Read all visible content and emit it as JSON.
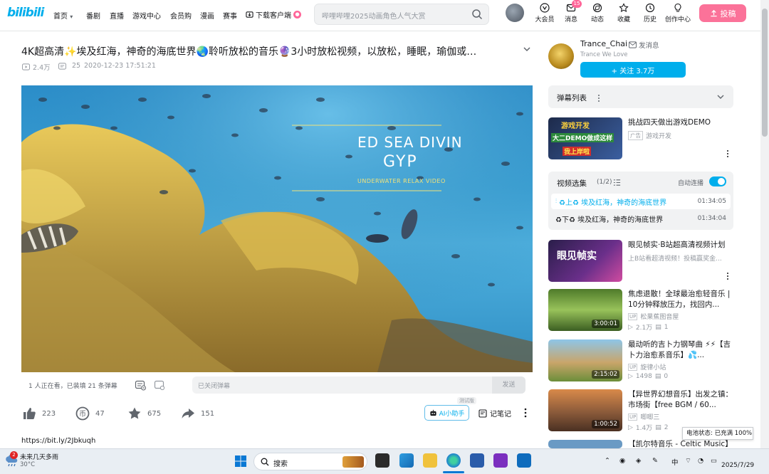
{
  "header": {
    "logo": "bilibili",
    "nav": [
      {
        "label": "首页"
      },
      {
        "label": "番剧"
      },
      {
        "label": "直播"
      },
      {
        "label": "游戏中心"
      },
      {
        "label": "会员购"
      },
      {
        "label": "漫画"
      },
      {
        "label": "赛事"
      },
      {
        "label": "下载客户端"
      }
    ],
    "search_placeholder": "哔哩哔哩2025动画角色人气大赏",
    "user_menu": [
      {
        "label": "大会员",
        "icon": "vip-icon"
      },
      {
        "label": "消息",
        "icon": "message-icon",
        "badge": "15"
      },
      {
        "label": "动态",
        "icon": "dynamic-icon"
      },
      {
        "label": "收藏",
        "icon": "star-icon"
      },
      {
        "label": "历史",
        "icon": "history-icon"
      },
      {
        "label": "创作中心",
        "icon": "bulb-icon"
      }
    ],
    "upload_label": "投稿"
  },
  "video": {
    "title": "4K超高清✨埃及红海，神奇的海底世界🌏聆听放松的音乐🔮3小时放松视频，以放松，睡眠，瑜伽或…",
    "views": "2.4万",
    "danmaku_count": "25",
    "date": "2020-12-23 17:51:21",
    "overlay_line1": "ED SEA DIVIN",
    "overlay_line2": "GYP",
    "overlay_line3": "UNDERWATER RELAX VIDEO"
  },
  "danmaku_bar": {
    "info": "1 人正在看，已装填 21 条弹幕",
    "input_placeholder": "已关闭弹幕",
    "send_label": "发送"
  },
  "actions": {
    "like": "223",
    "coin": "47",
    "favorite": "675",
    "share": "151",
    "ai_label": "AI小助手",
    "ai_tag": "测试版",
    "note_label": "记笔记"
  },
  "description": {
    "link": "https://bit.ly/2Jbkuqh"
  },
  "uploader": {
    "name": "Trance_Chai",
    "message_label": "发消息",
    "sign": "Trance We Love",
    "follow_label": "+ 关注 3.7万"
  },
  "danmaku_list": {
    "label": "弹幕列表"
  },
  "ad": {
    "title": "挑战四天做出游戏DEMO",
    "tag": "广告",
    "sub": "游戏开发",
    "thumb_text1": "游戏开发",
    "thumb_text2": "大二DEMO做成这样",
    "thumb_text3": "我上岸啦"
  },
  "series": {
    "title": "视频选集",
    "count": "(1/2)",
    "autoplay_label": "自动连播",
    "autoplay_on": true,
    "episodes": [
      {
        "title": "♻上♻ 埃及红海，神奇的海底世界",
        "duration": "01:34:05",
        "active": true
      },
      {
        "title": "♻下♻ 埃及红海，神奇的海底世界",
        "duration": "01:34:04",
        "active": false
      }
    ]
  },
  "recommendations": [
    {
      "title": "眼见帧实·B站超高清视频计划",
      "sub1": "上B站看超清视频！投稿赢奖金...",
      "sub2": "",
      "views": "",
      "danmaku": "",
      "duration": "",
      "thumb_text": "眼见帧实"
    },
    {
      "title": "焦虑退散！全球最治愈轻音乐 | 10分钟释放压力，找回内...",
      "sub1": "松果蕉图音屋",
      "sub2": "",
      "views": "2.1万",
      "danmaku": "1",
      "duration": "3:00:01"
    },
    {
      "title": "最动听的吉卜力钢琴曲 ⚡⚡【吉卜力治愈系音乐】💦...",
      "sub1": "旋律小站",
      "sub2": "",
      "views": "1498",
      "danmaku": "0",
      "duration": "2:15:02"
    },
    {
      "title": "【异世界幻想音乐】出发之镇：市场街【free BGM / 60...",
      "sub1": "唧唧三",
      "sub2": "",
      "views": "1.4万",
      "danmaku": "2",
      "duration": "1:00:52"
    },
    {
      "title": "【凯尔特音乐 - Celtic Music】",
      "sub1": "",
      "sub2": "",
      "views": "",
      "danmaku": "",
      "duration": ""
    }
  ],
  "taskbar": {
    "weather_title": "未来几天多雨",
    "weather_temp": "30°C",
    "weather_badge": "2",
    "search_label": "搜索",
    "ime": "中",
    "date": "2025/7/29",
    "battery_tip": "电池状态: 已充满 100%"
  },
  "colors": {
    "brand": "#00aeec",
    "pink": "#fb7299",
    "bg_gray": "#f1f2f3"
  }
}
